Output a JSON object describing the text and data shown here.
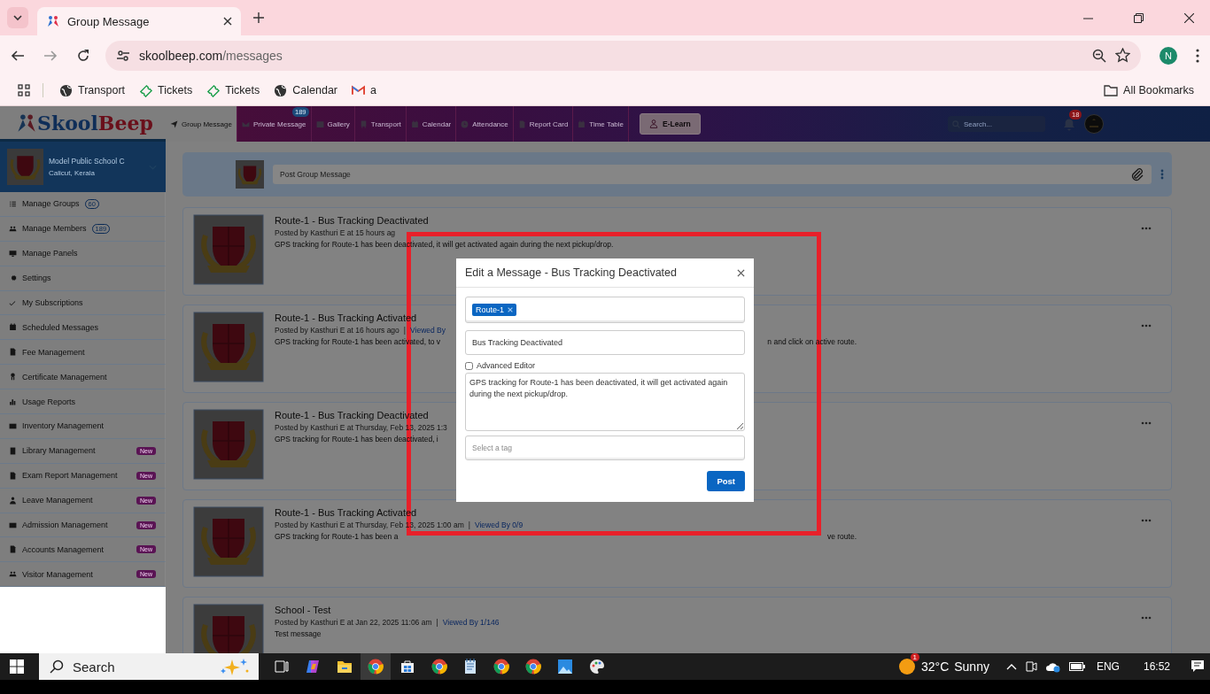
{
  "browser": {
    "tab_title": "Group Message",
    "url_host": "skoolbeep.com",
    "url_path": "/messages",
    "profile": "N",
    "bookmarks": [
      {
        "label": "Transport"
      },
      {
        "label": "Tickets"
      },
      {
        "label": "Tickets"
      },
      {
        "label": "Calendar"
      },
      {
        "label": "a"
      }
    ],
    "all_bookmarks": "All Bookmarks"
  },
  "header": {
    "logo_first": "Skool",
    "logo_second": "Beep",
    "nav": [
      {
        "label": "Group Message",
        "selected": true
      },
      {
        "label": "Private Message",
        "selected": false,
        "badge": "189"
      },
      {
        "label": "Gallery",
        "selected": false
      },
      {
        "label": "Transport",
        "selected": false
      },
      {
        "label": "Calendar",
        "selected": false
      },
      {
        "label": "Attendance",
        "selected": false
      },
      {
        "label": "Report Card",
        "selected": false
      },
      {
        "label": "Time Table",
        "selected": false
      }
    ],
    "elearn": "E-Learn",
    "search_placeholder": "Search...",
    "notifications": "18"
  },
  "sidebar": {
    "school_name": "Model Public School C",
    "school_place": "Calicut, Kerala",
    "items": [
      {
        "label": "Manage Groups",
        "count": "60"
      },
      {
        "label": "Manage Members",
        "count": "189"
      },
      {
        "label": "Manage Panels"
      },
      {
        "label": "Settings"
      },
      {
        "label": "My Subscriptions"
      },
      {
        "label": "Scheduled Messages"
      },
      {
        "label": "Fee Management"
      },
      {
        "label": "Certificate Management"
      },
      {
        "label": "Usage Reports"
      },
      {
        "label": "Inventory Management"
      },
      {
        "label": "Library Management",
        "tag": "New"
      },
      {
        "label": "Exam Report Management",
        "tag": "New"
      },
      {
        "label": "Leave Management",
        "tag": "New"
      },
      {
        "label": "Admission Management",
        "tag": "New"
      },
      {
        "label": "Accounts Management",
        "tag": "New"
      },
      {
        "label": "Visitor Management",
        "tag": "New"
      }
    ]
  },
  "composer": {
    "placeholder": "Post Group Message"
  },
  "messages": [
    {
      "title": "Route-1 - Bus Tracking Deactivated",
      "posted": "Posted by Kasthuri E at 15 hours ag",
      "body": "GPS tracking for Route-1 has been deactivated, it will get activated again during the next pickup/drop."
    },
    {
      "title": "Route-1 - Bus Tracking Activated",
      "posted": "Posted by Kasthuri E at 16 hours ago",
      "separator": "|",
      "viewed": "Viewed By",
      "body": "GPS tracking for Route-1 has been activated, to v",
      "body_end": "n and click on active route."
    },
    {
      "title": "Route-1 - Bus Tracking Deactivated",
      "posted": "Posted by Kasthuri E at Thursday, Feb 13, 2025 1:3",
      "body": "GPS tracking for Route-1 has been deactivated, i"
    },
    {
      "title": "Route-1 - Bus Tracking Activated",
      "posted": "Posted by Kasthuri E at Thursday, Feb 13, 2025 1:00 am",
      "separator": "|",
      "viewed": "Viewed By 0/9",
      "body": "GPS tracking for Route-1 has been a",
      "body_end": "ve route."
    },
    {
      "title": "School - Test",
      "posted": "Posted by Kasthuri E at Jan 22, 2025 11:06 am",
      "separator": "|",
      "viewed": "Viewed By 1/146",
      "body": "Test message"
    }
  ],
  "modal": {
    "title": "Edit a Message - Bus Tracking Deactivated",
    "recipients": [
      {
        "label": "Route-1"
      }
    ],
    "subject": "Bus Tracking Deactivated",
    "advanced_editor": {
      "label": "Advanced Editor",
      "checked": false
    },
    "body": "GPS tracking for Route-1 has been deactivated, it will get activated again during the next pickup/drop.",
    "tag_placeholder": "Select a tag",
    "submit": "Post"
  },
  "taskbar": {
    "search": "Search",
    "weather_badge": "1",
    "temperature": "32°C",
    "condition": "Sunny",
    "language": "ENG",
    "time": "16:52"
  }
}
